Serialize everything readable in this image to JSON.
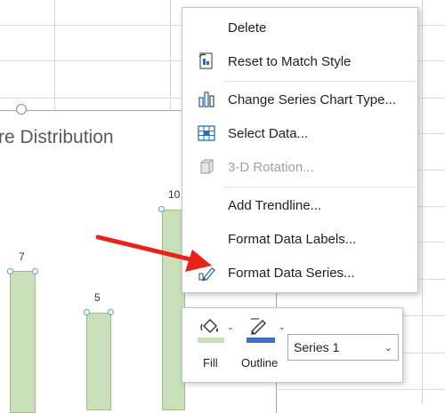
{
  "chart": {
    "title": "re Distribution",
    "bars": [
      {
        "label": "7"
      },
      {
        "label": "5"
      },
      {
        "label": "10"
      }
    ]
  },
  "context_menu": {
    "items": [
      {
        "label": "Delete",
        "icon": "none",
        "enabled": true
      },
      {
        "label": "Reset to Match Style",
        "icon": "reset-style-icon",
        "enabled": true
      },
      {
        "label": "Change Series Chart Type...",
        "icon": "chart-type-icon",
        "enabled": true
      },
      {
        "label": "Select Data...",
        "icon": "select-data-icon",
        "enabled": true
      },
      {
        "label": "3-D Rotation...",
        "icon": "3d-rotation-icon",
        "enabled": false
      },
      {
        "label": "Add Trendline...",
        "icon": "none",
        "enabled": true
      },
      {
        "label": "Format Data Labels...",
        "icon": "none",
        "enabled": true
      },
      {
        "label": "Format Data Series...",
        "icon": "format-series-icon",
        "enabled": true
      }
    ]
  },
  "mini_toolbar": {
    "fill_label": "Fill",
    "outline_label": "Outline",
    "series_value": "Series 1",
    "fill_color": "#c9dfba",
    "outline_color": "#3a6fc4"
  },
  "colors": {
    "bar_fill": "#c9dfba",
    "arrow": "#e8221b",
    "selection": "#5b9bd5"
  }
}
